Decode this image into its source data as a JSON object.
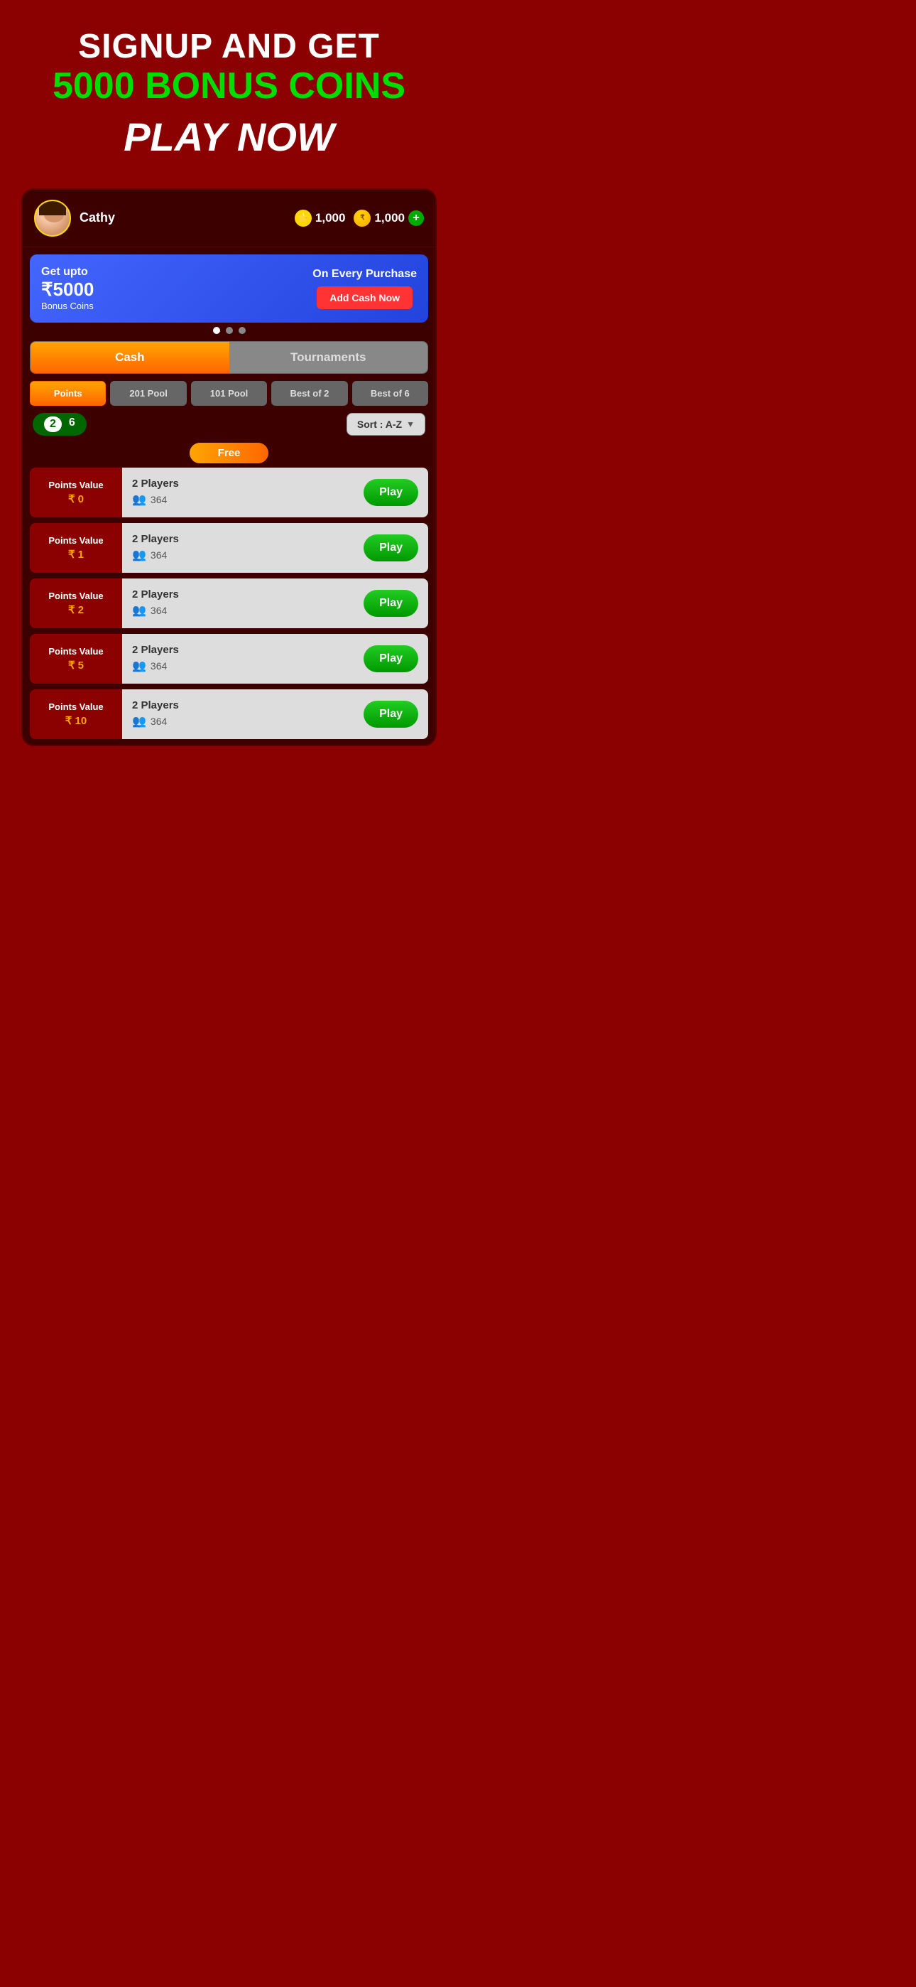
{
  "hero": {
    "line1": "SIGNUP AND GET",
    "line2": "5000 BONUS COINS",
    "line3": "PLAY NOW"
  },
  "header": {
    "username": "Cathy",
    "stars": "1,000",
    "coins": "1,000"
  },
  "banner": {
    "get_upto": "Get upto",
    "amount": "₹5000",
    "bonus_coins": "Bonus Coins",
    "on_every": "On Every Purchase",
    "add_cash": "Add Cash Now"
  },
  "tabs": {
    "cash": "Cash",
    "tournaments": "Tournaments"
  },
  "filters": {
    "points": "Points",
    "pool201": "201 Pool",
    "pool101": "101 Pool",
    "best2": "Best of 2",
    "best6": "Best of 6"
  },
  "toggle": {
    "val1": "2",
    "val2": "6"
  },
  "sort": {
    "label": "Sort : A-Z"
  },
  "free_label": "Free",
  "game_rows": [
    {
      "label": "Points Value",
      "value": "₹ 0",
      "players": "2 Players",
      "count": "364",
      "btn": "Play"
    },
    {
      "label": "Points Value",
      "value": "₹ 1",
      "players": "2 Players",
      "count": "364",
      "btn": "Play"
    },
    {
      "label": "Points Value",
      "value": "₹ 2",
      "players": "2 Players",
      "count": "364",
      "btn": "Play"
    },
    {
      "label": "Points Value",
      "value": "₹ 5",
      "players": "2 Players",
      "count": "364",
      "btn": "Play"
    },
    {
      "label": "Points Value",
      "value": "₹ 10",
      "players": "2 Players",
      "count": "364",
      "btn": "Play"
    }
  ]
}
